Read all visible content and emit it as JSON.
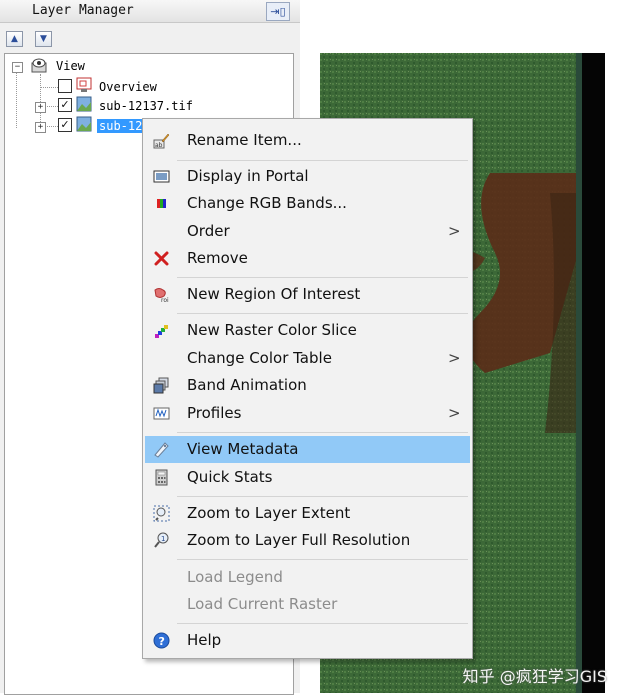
{
  "panel": {
    "title": "Layer Manager",
    "dock_icon": "dock-icon"
  },
  "tree": {
    "root": "View",
    "items": [
      {
        "label": "Overview",
        "checked": false
      },
      {
        "label": "sub-12137.tif",
        "checked": true
      },
      {
        "label": "sub-12",
        "checked": true,
        "selected": true
      }
    ]
  },
  "menu": {
    "items": [
      {
        "label": "Rename Item...",
        "icon": "rename-icon"
      },
      {
        "label": "Display in Portal",
        "icon": "portal-icon"
      },
      {
        "label": "Change RGB Bands...",
        "icon": "rgb-bands-icon"
      },
      {
        "label": "Order",
        "submenu": true
      },
      {
        "label": "Remove",
        "icon": "remove-icon"
      },
      {
        "label": "New Region Of Interest",
        "icon": "roi-icon"
      },
      {
        "label": "New Raster Color Slice",
        "icon": "color-slice-icon"
      },
      {
        "label": "Change Color Table",
        "submenu": true
      },
      {
        "label": "Band Animation",
        "icon": "band-animation-icon"
      },
      {
        "label": "Profiles",
        "icon": "profiles-icon",
        "submenu": true
      },
      {
        "label": "View Metadata",
        "icon": "metadata-icon",
        "highlighted": true
      },
      {
        "label": "Quick Stats",
        "icon": "calculator-icon"
      },
      {
        "label": "Zoom to Layer Extent",
        "icon": "zoom-extent-icon"
      },
      {
        "label": "Zoom to Layer Full Resolution",
        "icon": "zoom-full-icon"
      },
      {
        "label": "Load Legend",
        "disabled": true
      },
      {
        "label": "Load Current Raster",
        "disabled": true
      },
      {
        "label": "Help",
        "icon": "help-icon"
      }
    ],
    "submenu_glyph": ">"
  },
  "watermark": "知乎 @疯狂学习GIS",
  "colors": {
    "selection": "#3399ff",
    "highlight": "#91c9f7",
    "raster_green": "#3e6a3a",
    "raster_brown": "#5a2c18"
  }
}
